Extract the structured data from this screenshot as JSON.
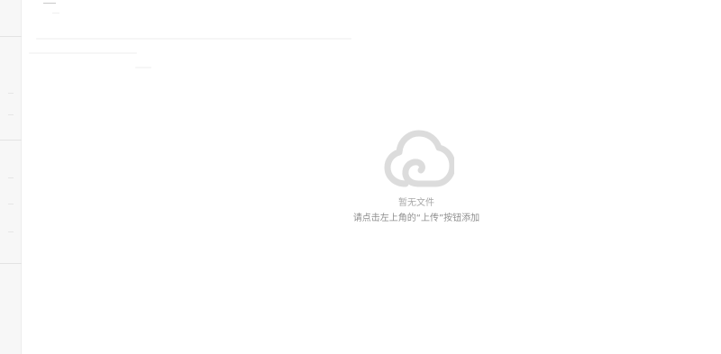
{
  "header": {
    "stub_label": ""
  },
  "empty_state": {
    "icon": "cloud-icon",
    "title": "暂无文件",
    "hint": "请点击左上角的“上传”按钮添加"
  },
  "colors": {
    "icon": "#dcdcdc",
    "title_text": "#a8a8a8",
    "hint_text": "#8e8e8e",
    "sidebar_bg": "#f7f7f7"
  }
}
